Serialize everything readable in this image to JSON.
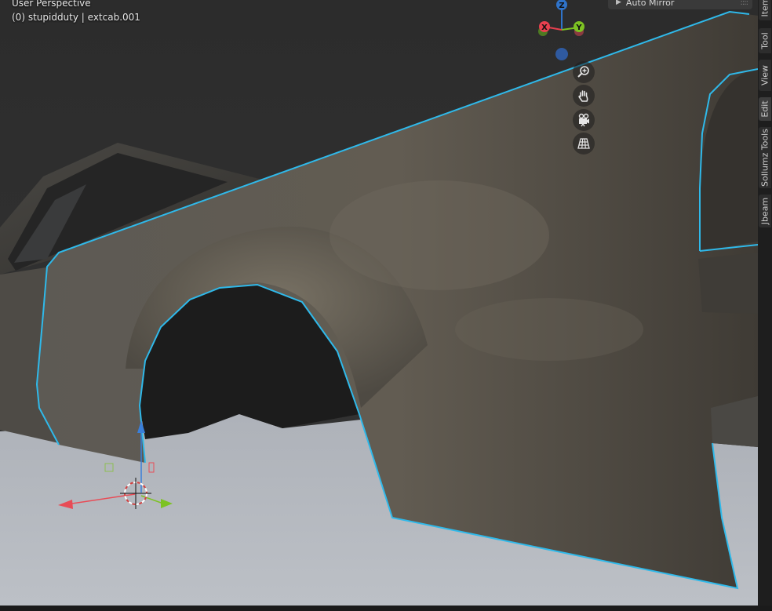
{
  "viewport": {
    "view_name": "User Perspective",
    "object_info": "(0) stupidduty | extcab.001"
  },
  "last_operator_panel": {
    "label": "Auto Mirror"
  },
  "gizmo": {
    "axis_x": "X",
    "axis_y": "Y",
    "axis_z": "Z",
    "colors": {
      "x": "#e8404f",
      "y": "#7dc223",
      "z": "#2f73c9"
    }
  },
  "nav_buttons": [
    {
      "name": "zoom",
      "icon": "zoom-in-icon"
    },
    {
      "name": "pan",
      "icon": "hand-icon"
    },
    {
      "name": "camera",
      "icon": "camera-icon"
    },
    {
      "name": "perspective",
      "icon": "grid-icon"
    }
  ],
  "sidebar_tabs": [
    "Item",
    "Tool",
    "View",
    "Edit",
    "Sollumz Tools",
    "Jbeam"
  ],
  "active_tab": "Edit",
  "colors": {
    "selection_outline": "#2fb9ea",
    "ground": "#b4b8bf",
    "background": "#2a2a2a"
  }
}
